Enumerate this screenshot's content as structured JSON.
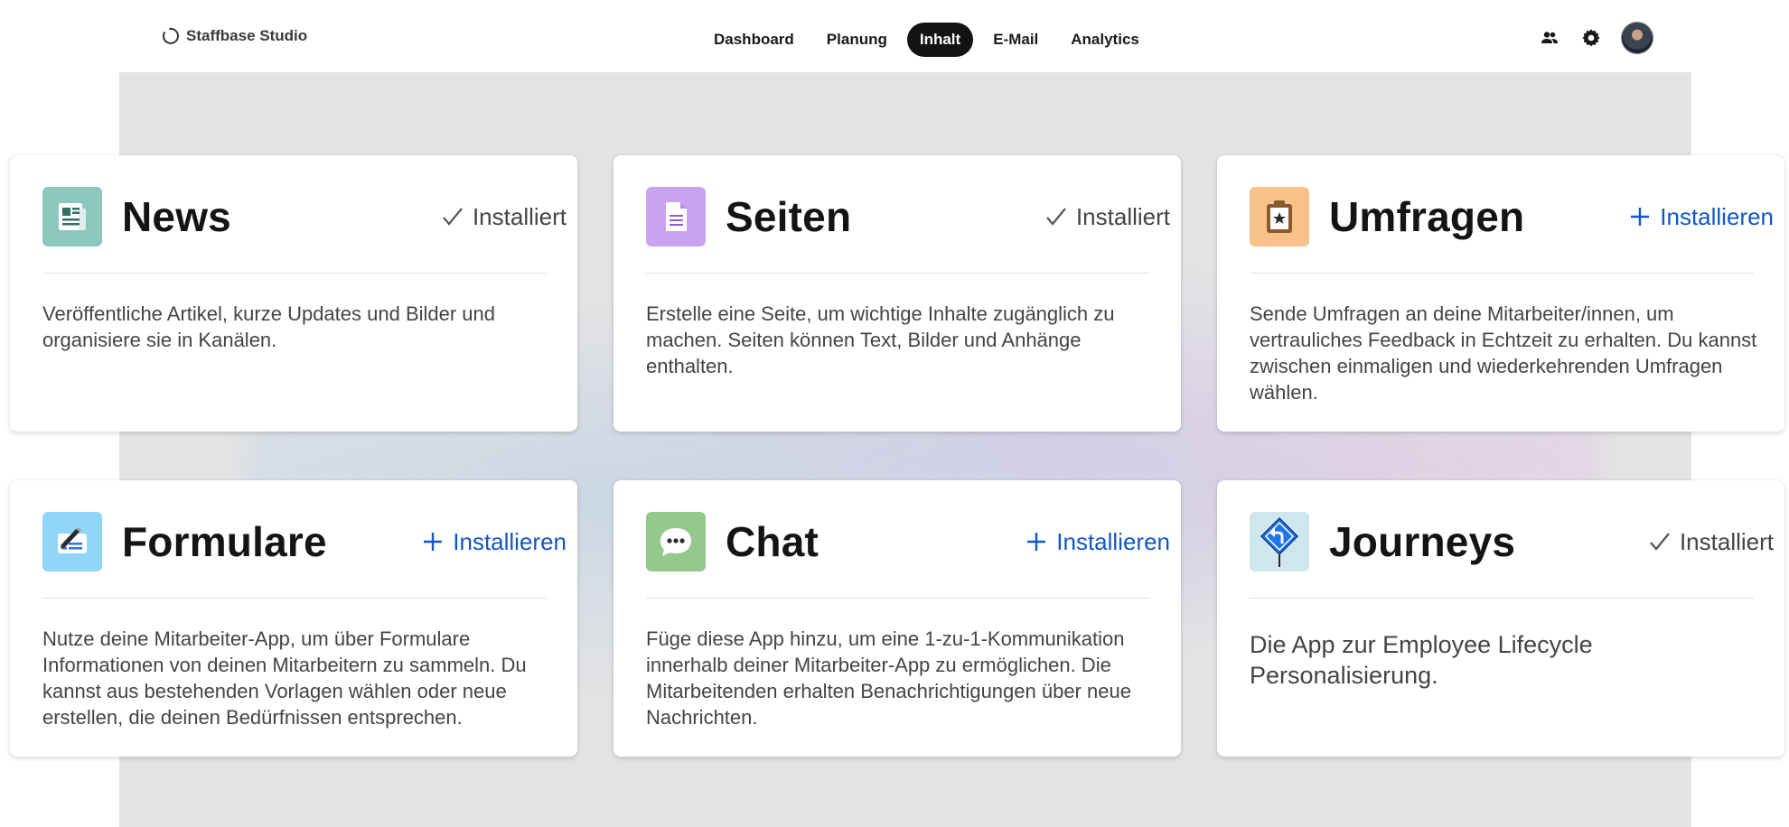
{
  "brand": {
    "name": "Staffbase Studio"
  },
  "nav": {
    "items": [
      {
        "label": "Dashboard"
      },
      {
        "label": "Planung"
      },
      {
        "label": "Inhalt"
      },
      {
        "label": "E-Mail"
      },
      {
        "label": "Analytics"
      }
    ],
    "active": "Inhalt"
  },
  "apps": [
    {
      "title": "News",
      "status": "installed",
      "action_label": "Installiert",
      "icon": "newspaper-icon",
      "icon_bg": "#8cc7bd",
      "description": "Veröffentliche Artikel, kurze Updates und Bilder und organisiere sie in Kanälen."
    },
    {
      "title": "Seiten",
      "status": "installed",
      "action_label": "Installiert",
      "icon": "document-icon",
      "icon_bg": "#c9a3f0",
      "description": "Erstelle eine Seite, um wichtige Inhalte zugänglich zu machen. Seiten können Text, Bilder und Anhänge enthalten."
    },
    {
      "title": "Umfragen",
      "status": "not_installed",
      "action_label": "Installieren",
      "icon": "clipboard-star-icon",
      "icon_bg": "#f7c28a",
      "description": "Sende Umfragen an deine Mitarbeiter/innen, um vertrauliches Feedback in Echtzeit zu erhalten. Du kannst zwischen einmaligen und wiederkehrenden Umfragen wählen."
    },
    {
      "title": "Formulare",
      "status": "not_installed",
      "action_label": "Installieren",
      "icon": "form-pen-icon",
      "icon_bg": "#8fd6f8",
      "description": "Nutze deine Mitarbeiter-App, um über Formulare Informationen von deinen Mitarbeitern zu sammeln. Du kannst aus bestehenden Vorlagen wählen oder neue erstellen, die deinen Bedürfnissen entsprechen."
    },
    {
      "title": "Chat",
      "status": "not_installed",
      "action_label": "Installieren",
      "icon": "chat-bubble-icon",
      "icon_bg": "#93c98a",
      "description": "Füge diese App hinzu, um eine 1-zu-1-Kommunikation innerhalb deiner Mitarbeiter-App zu ermöglichen. Die Mitarbeitenden erhalten Benachrichtigungen über neue Nachrichten."
    },
    {
      "title": "Journeys",
      "status": "installed",
      "action_label": "Installiert",
      "icon": "road-sign-icon",
      "icon_bg": "#cfe6ee",
      "description": "Die App zur Employee Lifecycle Personalisierung."
    }
  ],
  "colors": {
    "accent": "#1257c4",
    "nav_active_bg": "#131313",
    "canvas_bg": "#e3e3e5"
  }
}
